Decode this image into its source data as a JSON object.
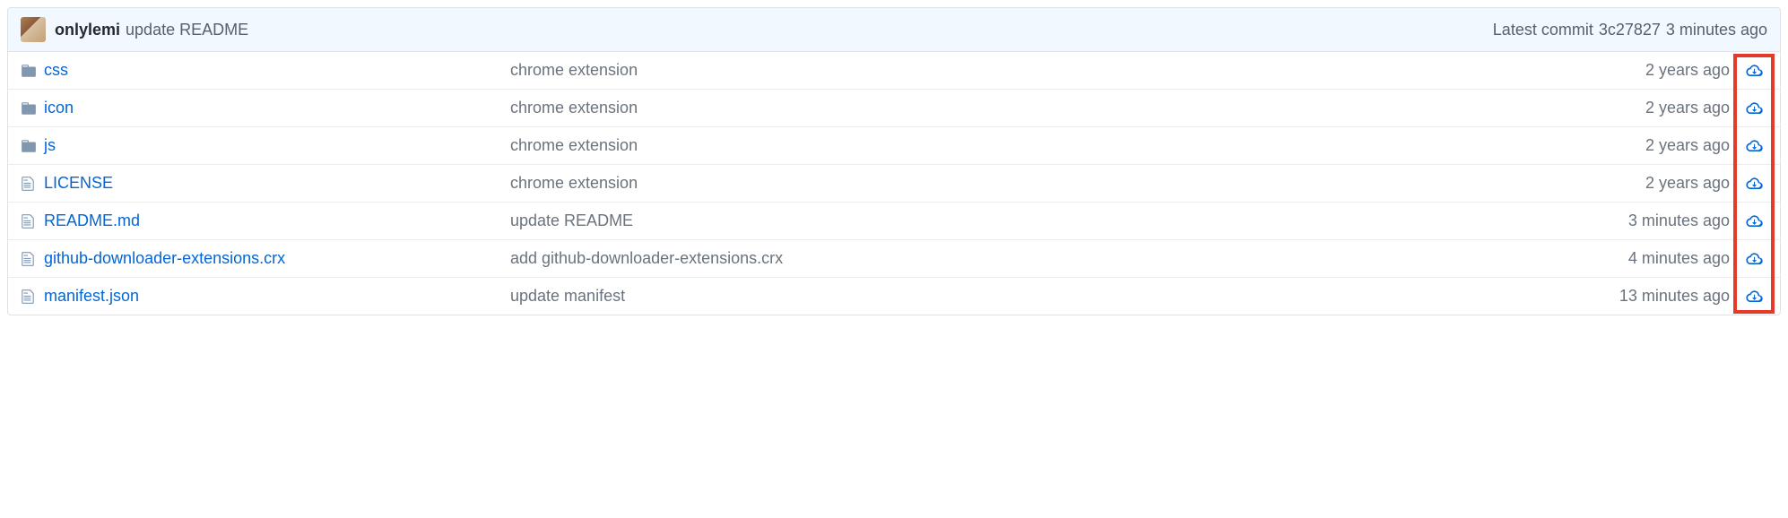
{
  "commit_tease": {
    "author": "onlylemi",
    "message": "update README",
    "latest_label": "Latest commit",
    "sha": "3c27827",
    "age": "3 minutes ago"
  },
  "files": [
    {
      "type": "folder",
      "name": "css",
      "message": "chrome extension",
      "age": "2 years ago"
    },
    {
      "type": "folder",
      "name": "icon",
      "message": "chrome extension",
      "age": "2 years ago"
    },
    {
      "type": "folder",
      "name": "js",
      "message": "chrome extension",
      "age": "2 years ago"
    },
    {
      "type": "file",
      "name": "LICENSE",
      "message": "chrome extension",
      "age": "2 years ago"
    },
    {
      "type": "file",
      "name": "README.md",
      "message": "update README",
      "age": "3 minutes ago"
    },
    {
      "type": "file",
      "name": "github-downloader-extensions.crx",
      "message": "add github-downloader-extensions.crx",
      "age": "4 minutes ago"
    },
    {
      "type": "file",
      "name": "manifest.json",
      "message": "update manifest",
      "age": "13 minutes ago"
    }
  ],
  "highlight": {
    "column": "download"
  }
}
